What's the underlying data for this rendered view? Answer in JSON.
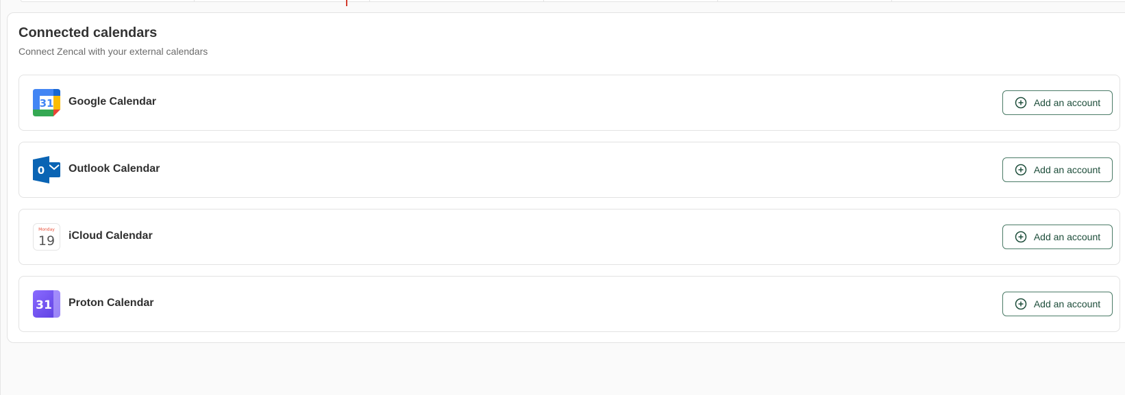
{
  "section": {
    "title": "Connected calendars",
    "subtitle": "Connect Zencal with your external calendars"
  },
  "calendars": [
    {
      "name": "Google Calendar",
      "icon": "google-calendar-icon",
      "icon_text": "31",
      "button_label": "Add an account"
    },
    {
      "name": "Outlook Calendar",
      "icon": "outlook-icon",
      "icon_text": "0",
      "button_label": "Add an account"
    },
    {
      "name": "iCloud Calendar",
      "icon": "icloud-calendar-icon",
      "icon_text": "19",
      "icon_day": "Monday",
      "button_label": "Add an account"
    },
    {
      "name": "Proton Calendar",
      "icon": "proton-calendar-icon",
      "icon_text": "31",
      "button_label": "Add an account"
    }
  ],
  "colors": {
    "button_border": "#4a7a66",
    "button_text": "#1d4d3a",
    "google_blue": "#4285f4",
    "outlook_blue": "#0a64b4",
    "proton_purple": "#6d4aff",
    "tab_marker": "#d33a2c"
  }
}
